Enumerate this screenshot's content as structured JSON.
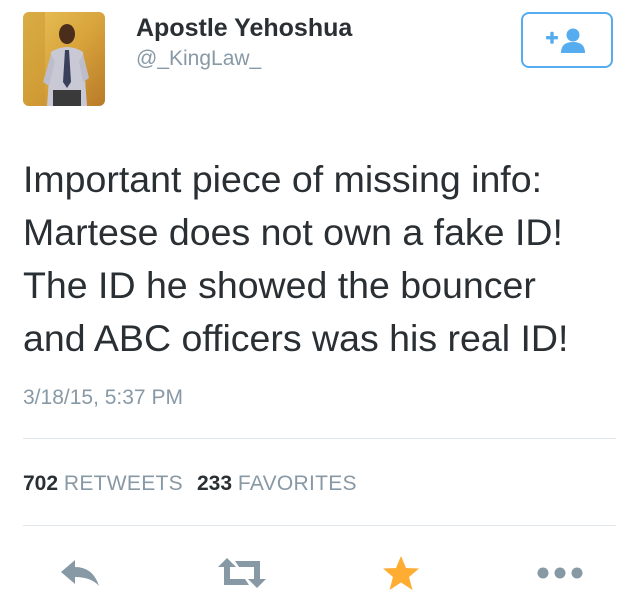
{
  "user": {
    "display_name": "Apostle Yehoshua",
    "handle": "@_KingLaw_"
  },
  "follow_button": {
    "icon": "add-follow-icon"
  },
  "tweet": {
    "lines": [
      "Important piece of missing info:",
      "Martese does not own a fake ID!",
      "The ID he showed the bouncer",
      "and ABC officers was his real ID!"
    ],
    "timestamp": "3/18/15, 5:37 PM"
  },
  "stats": {
    "retweets_count": "702",
    "retweets_label": "RETWEETS",
    "favorites_count": "233",
    "favorites_label": "FAVORITES"
  },
  "actions": {
    "reply_icon": "reply-icon",
    "retweet_icon": "retweet-icon",
    "favorite_icon": "star-icon",
    "more_icon": "more-dots-icon"
  },
  "colors": {
    "accent_blue": "#55acee",
    "icon_gray": "#8899a6",
    "favorite_gold": "#ffac33",
    "text_dark": "#292f33",
    "divider": "#e1e8ed"
  }
}
